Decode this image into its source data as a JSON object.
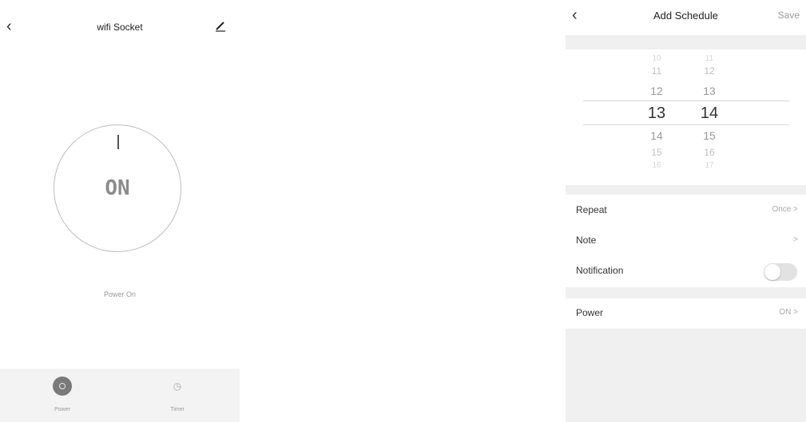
{
  "left": {
    "title": "wifi Socket",
    "back_icon": "chevron-left-icon",
    "edit_icon": "pencil-icon",
    "dial_label": "ON",
    "status_text": "Power On",
    "tabs": [
      {
        "label": "Power",
        "icon": "power-icon",
        "active": true
      },
      {
        "label": "Timer",
        "icon": "timer-icon",
        "active": false
      }
    ]
  },
  "right": {
    "title": "Add Schedule",
    "save_label": "Save",
    "back_icon": "chevron-left-icon",
    "picker": {
      "hours": [
        "10",
        "11",
        "12",
        "13",
        "14",
        "15",
        "16"
      ],
      "minutes": [
        "11",
        "12",
        "13",
        "14",
        "15",
        "16",
        "17"
      ],
      "selected_hour": "13",
      "selected_minute": "14"
    },
    "rows": {
      "repeat": {
        "label": "Repeat",
        "value": "Once"
      },
      "note": {
        "label": "Note",
        "value": ""
      },
      "notification": {
        "label": "Notification",
        "enabled": false
      },
      "power": {
        "label": "Power",
        "value": "ON"
      }
    },
    "chevron": ">"
  },
  "colors": {
    "background": "#ffffff",
    "section_gray": "#f0f0f0",
    "dial_text": "#8c8c8c",
    "muted_text": "#a8a8a8"
  }
}
